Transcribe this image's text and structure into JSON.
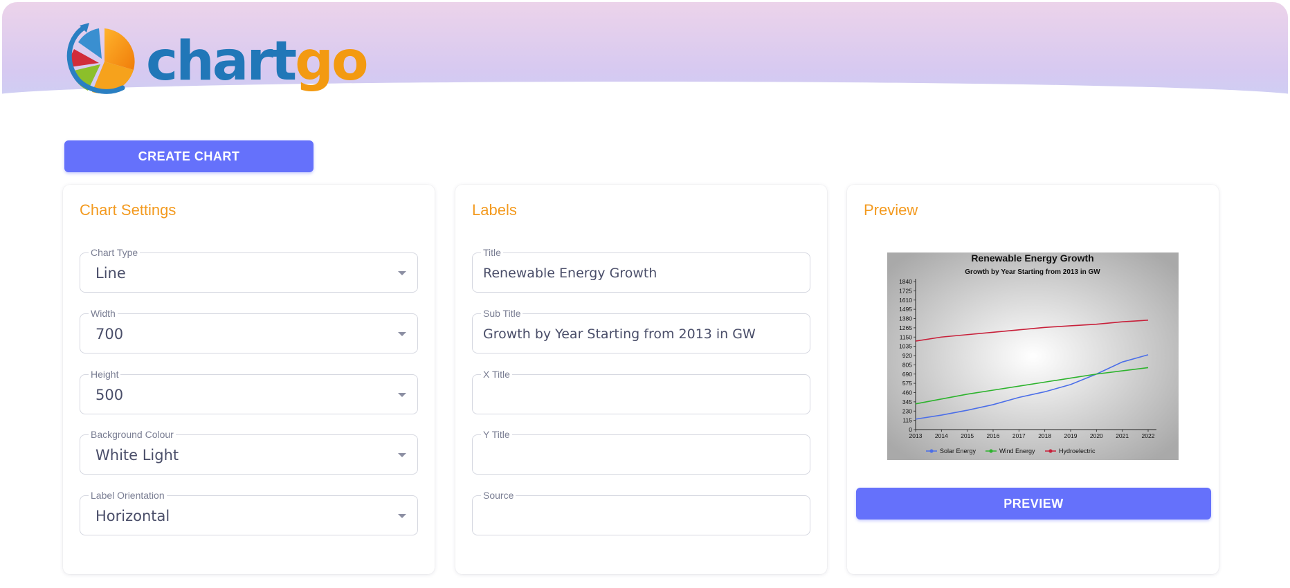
{
  "header": {
    "logo_text_part1": "chart",
    "logo_text_part2": "go"
  },
  "create_button": "CREATE CHART",
  "settings": {
    "title": "Chart Settings",
    "fields": [
      {
        "label": "Chart Type",
        "value": "Line"
      },
      {
        "label": "Width",
        "value": "700"
      },
      {
        "label": "Height",
        "value": "500"
      },
      {
        "label": "Background Colour",
        "value": "White Light"
      },
      {
        "label": "Label Orientation",
        "value": "Horizontal"
      }
    ]
  },
  "labels": {
    "title": "Labels",
    "fields": [
      {
        "label": "Title",
        "value": "Renewable Energy Growth"
      },
      {
        "label": "Sub Title",
        "value": "Growth by Year Starting from 2013 in GW"
      },
      {
        "label": "X Title",
        "value": ""
      },
      {
        "label": "Y Title",
        "value": ""
      },
      {
        "label": "Source",
        "value": ""
      }
    ]
  },
  "preview": {
    "title": "Preview",
    "button": "PREVIEW"
  },
  "colors": {
    "accent": "#6571fb",
    "heading": "#f39a1f",
    "solar": "#4b6ee8",
    "wind": "#2db32d",
    "hydro": "#c8203a"
  },
  "chart_data": {
    "type": "line",
    "title": "Renewable Energy Growth",
    "subtitle": "Growth by Year Starting from 2013 in GW",
    "x": [
      "2013",
      "2014",
      "2015",
      "2016",
      "2017",
      "2018",
      "2019",
      "2020",
      "2021",
      "2022"
    ],
    "yticks": [
      "0",
      "115",
      "230",
      "345",
      "460",
      "575",
      "690",
      "805",
      "920",
      "1035",
      "1150",
      "1265",
      "1380",
      "1495",
      "1610",
      "1725",
      "1840"
    ],
    "ylim": [
      0,
      1840
    ],
    "grid": false,
    "legend": "bottom",
    "series": [
      {
        "name": "Solar Energy",
        "color": "#4b6ee8",
        "values": [
          130,
          180,
          240,
          310,
          400,
          470,
          560,
          690,
          840,
          930
        ]
      },
      {
        "name": "Wind Energy",
        "color": "#2db32d",
        "values": [
          320,
          380,
          440,
          490,
          540,
          590,
          640,
          690,
          730,
          770
        ]
      },
      {
        "name": "Hydroelectric",
        "color": "#c8203a",
        "values": [
          1100,
          1150,
          1180,
          1210,
          1240,
          1270,
          1290,
          1310,
          1340,
          1360
        ]
      }
    ]
  }
}
